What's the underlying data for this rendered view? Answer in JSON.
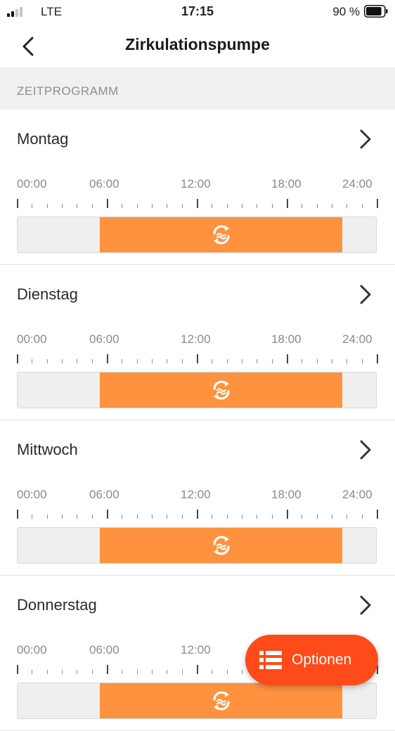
{
  "status_bar": {
    "carrier": "LTE",
    "time": "17:15",
    "battery_percent": "90 %",
    "battery_level": 0.9,
    "signal_bars_active": 2,
    "signal_bars_total": 4
  },
  "nav": {
    "title": "Zirkulationspumpe",
    "back_icon": "chevron-left-icon"
  },
  "section": {
    "title": "ZEITPROGRAMM"
  },
  "timeline": {
    "labels": [
      "00:00",
      "06:00",
      "12:00",
      "18:00",
      "24:00"
    ],
    "range_hours": [
      0,
      24
    ]
  },
  "days": [
    {
      "name": "Montag",
      "active_start": 5.5,
      "active_end": 21.75
    },
    {
      "name": "Dienstag",
      "active_start": 5.5,
      "active_end": 21.75
    },
    {
      "name": "Mittwoch",
      "active_start": 5.5,
      "active_end": 21.75
    },
    {
      "name": "Donnerstag",
      "active_start": 5.5,
      "active_end": 21.75
    }
  ],
  "options_button": {
    "label": "Optionen",
    "icon": "list-icon"
  },
  "colors": {
    "active_segment": "#ff923f",
    "options_button": "#ff4a19",
    "section_header_bg": "#f0f0f0"
  }
}
